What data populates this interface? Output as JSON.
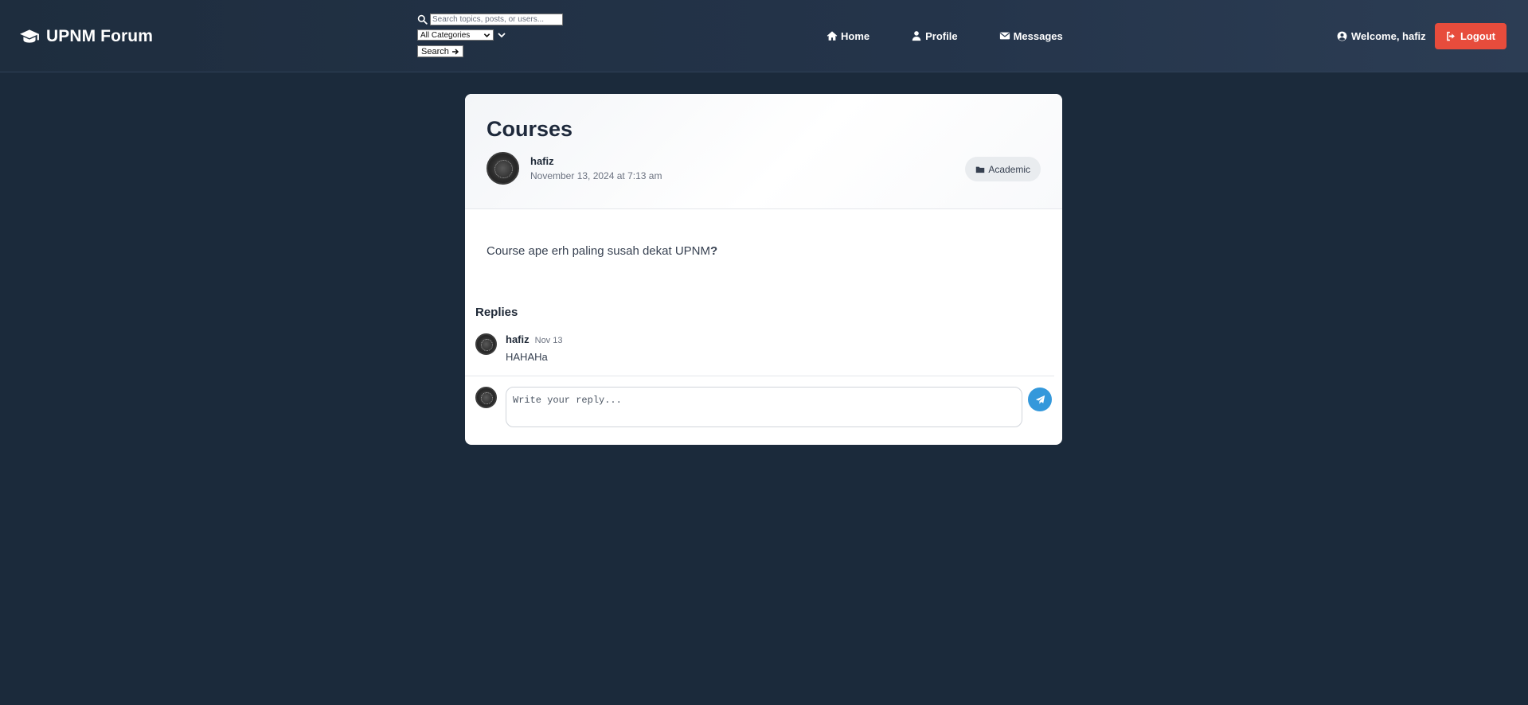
{
  "header": {
    "brand": "UPNM Forum",
    "brand_icon": "graduation-cap-icon",
    "search": {
      "placeholder": "Search topics, posts, or users...",
      "category_selected": "All Categories",
      "button_label": "Search"
    },
    "nav": [
      {
        "label": "Home",
        "icon": "home-icon"
      },
      {
        "label": "Profile",
        "icon": "user-icon"
      },
      {
        "label": "Messages",
        "icon": "envelope-icon"
      }
    ],
    "welcome": "Welcome, hafiz",
    "logout_label": "Logout"
  },
  "post": {
    "title": "Courses",
    "author": "hafiz",
    "date": "November 13, 2024 at 7:13 am",
    "category": "Academic",
    "body": "Course ape erh paling susah dekat UPNM",
    "body_mark": "?"
  },
  "replies": {
    "heading": "Replies",
    "items": [
      {
        "author": "hafiz",
        "date": "Nov 13",
        "text": "HAHAHa"
      }
    ],
    "compose_placeholder": "Write your reply..."
  },
  "colors": {
    "background": "#1b2a3b",
    "logout": "#e74c3c",
    "send": "#3498db"
  }
}
